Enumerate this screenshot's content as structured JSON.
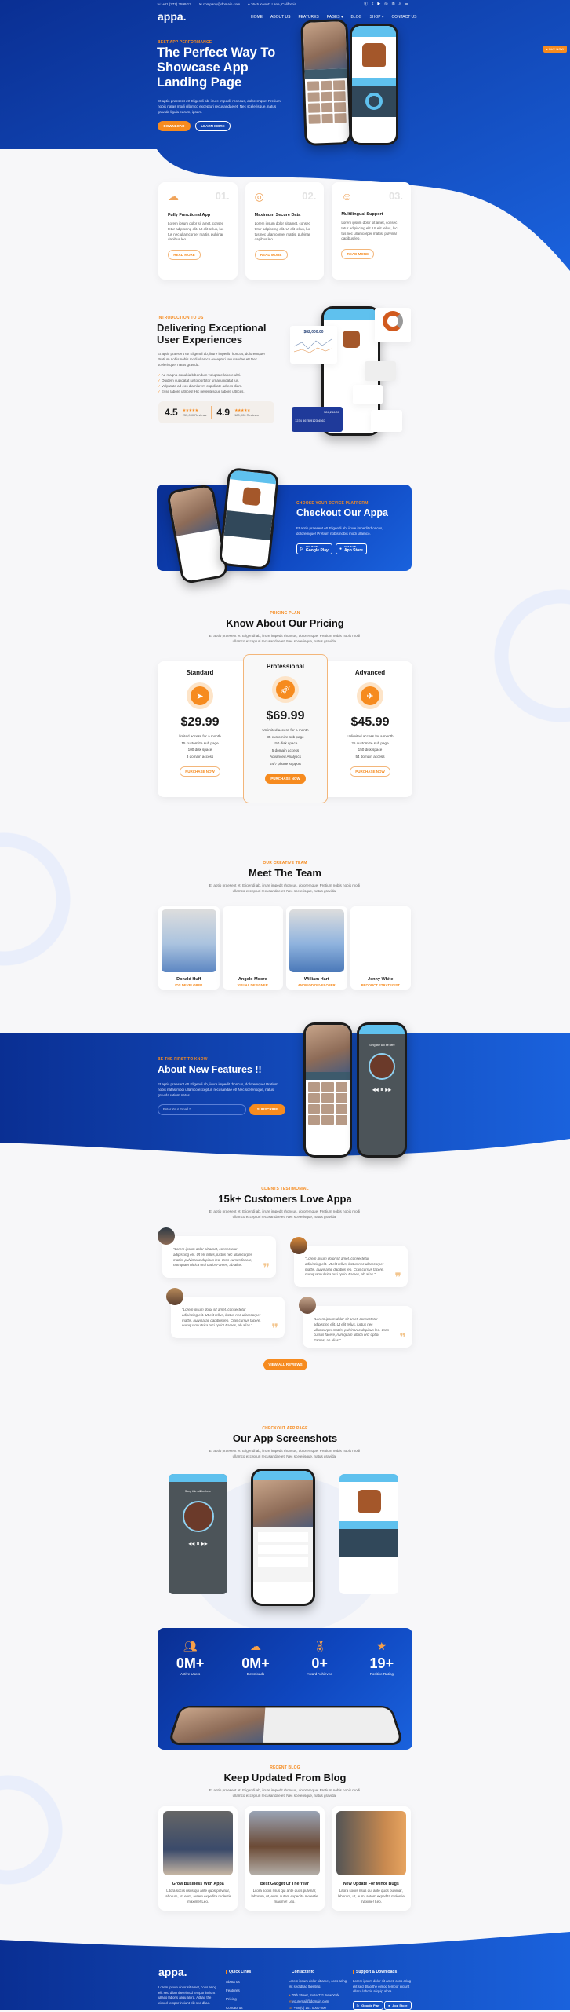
{
  "topbar": {
    "phone": "+01 (377) 2599 13",
    "email": "company@domain.com",
    "address": "3645 Koontz Lane, California",
    "social_icons": [
      "facebook-icon",
      "twitter-icon",
      "youtube-icon",
      "instagram-icon",
      "linkedin-icon",
      "search-icon",
      "menu-icon"
    ]
  },
  "nav": {
    "logo": "appa.",
    "items": [
      "HOME",
      "ABOUT US",
      "FEATURES",
      "PAGES",
      "BLOG",
      "SHOP",
      "CONTACT US"
    ],
    "active": "HOME"
  },
  "buy_now": "BUY NOW",
  "colors": {
    "primary": "#0f47c0",
    "accent": "#f68b1f"
  },
  "hero": {
    "tag": "BEST APP PERFORMANCE",
    "title": "The Perfect Way To Showcase App Landing Page",
    "text": "Et aptio praesent et! Eligendi ab, iirure impedit rhoncus, doloremque! Pretium nobis natas modi ullamco excepturi recusandae et! Nec scelerisque, natus gravida ligula earum, ipsam.",
    "download": "DOWNLOAD",
    "learn": "LEARN MORE"
  },
  "features": [
    {
      "num": "01.",
      "title": "Fully Functional App",
      "text": "Lorem ipsum dolor sit amet, consec tetur adipiscing elit. Ut elit tellus, luc tus nec ullamcorper mattis, pulvinar dapibus leo.",
      "btn": "READ MORE",
      "icon": "cloud-network-icon"
    },
    {
      "num": "02.",
      "title": "Maximum Secure Data",
      "text": "Lorem ipsum dolor sit amet, consec tetur adipiscing elit. Ut elit tellus, luc tus nec ullamcorper mattis, pulvinar dapibus leo.",
      "btn": "READ MORE",
      "icon": "secure-user-icon"
    },
    {
      "num": "03.",
      "title": "Multilingual Support",
      "text": "Lorem ipsum dolor sit amet, consec tetur adipiscing elit. Ut elit tellus, luc tus nec ullamcorper mattis, pulvinar dapibus leo.",
      "btn": "READ MORE",
      "icon": "chat-group-icon"
    }
  ],
  "intro": {
    "tag": "INTRODUCTION TO US",
    "title": "Delivering Exceptional User Experiences",
    "text": "Et aptio praesent et! Eligendi ab, iirure impedit rhoncus, doloremque! Pretium nobis nobis modi ullamco excepturi recusandae et! Nec scelerisque, natus gravida.",
    "list": [
      "Ad magna conubia bibendum voluptate labore ultri.",
      "Quidem cupidatat justo porttitor urnacupidatat jus.",
      "Vulputate ad eos diamlarem cupiditate ad eos diam.",
      "Esse labore ultrices! Hic pellentesque labore ultrices."
    ],
    "rating1": "4.5",
    "reviews1": "255,000 Reviews",
    "rating2": "4.9",
    "reviews2": "180,000 Reviews",
    "mock": {
      "balance": "$82,000.00",
      "card_no": "1234 5678 9123 4567",
      "card_amount": "$24,256.00"
    }
  },
  "checkout": {
    "tag": "CHOOSE YOUR DEVICE PLATFORM",
    "title": "Checkout Our Appa",
    "text": "Et aptio praesent et! Eligendi ab, iirure impedit rhoncus, doloremque! Pretium nobis nobis modi ullamco.",
    "google_small": "GET IT ON",
    "google": "Google Play",
    "apple_small": "GET IT ON",
    "apple": "App Store"
  },
  "pricing": {
    "tag": "PRICING PLAN",
    "title": "Know About Our Pricing",
    "text": "Et aptio praesent et! Eligendi ab, iirure impedit rhoncus, doloremque! Pretium nobis nobis modi ullamco excepturi recusandae et! Nec scelerisque, natus gravida.",
    "plans": [
      {
        "name": "Standard",
        "price": "$29.99",
        "features": [
          "limited access for a month",
          "15 customize sub page",
          "100 disk space",
          "3 domain access"
        ],
        "btn": "PURCHASE NOW",
        "icon": "paper-plane-icon"
      },
      {
        "name": "Professional",
        "price": "$69.99",
        "features": [
          "Unlimited access for a month",
          "35 customize sub page",
          "150 disk space",
          "5 domain access",
          "Advanced Analytics",
          "24/7 phone support"
        ],
        "btn": "PURCHASE NOW",
        "icon": "rocket-icon"
      },
      {
        "name": "Advanced",
        "price": "$45.99",
        "features": [
          "Unlimited access for a month",
          "25 customize sub page",
          "150 disk space",
          "54 domain access"
        ],
        "btn": "PURCHASE NOW",
        "icon": "airplane-icon"
      }
    ]
  },
  "team": {
    "tag": "OUR CREATIVE TEAM",
    "title": "Meet The Team",
    "text": "Et aptio praesent et! Eligendi ab, iirure impedit rhoncus, doloremque! Pretium nobis nobis modi ullamco excepturi recusandae et! Nec scelerisque, natus gravida.",
    "members": [
      {
        "name": "Donald Huff",
        "role": "IOS DEVELOPER"
      },
      {
        "name": "Angelo Moore",
        "role": "VISUAL DESIGNER"
      },
      {
        "name": "William Hart",
        "role": "ANDRIOD DEVELOPER"
      },
      {
        "name": "Jenny White",
        "role": "PRODUCT STRATEGIST"
      }
    ]
  },
  "newsletter": {
    "tag": "BE THE FIRST TO KNOW",
    "title": "About New Features !!",
    "text": "Et aptio praesent et! Eligendi ab, iirure impedit rhoncus, doloremque! Pretium nobis natas modi ullamco excepturi recusandae et! Nec scelerisque, natus gravida retium natas.",
    "placeholder": "Enter Your Email *",
    "btn": "SUBSCRIBE",
    "song": "Song title will be here"
  },
  "testimonials": {
    "tag": "CLIENTS TESTIMONIAL",
    "title": "15k+ Customers Love Appa",
    "text": "Et aptio praesent et! Eligendi ab, iirure impedit rhoncus, doloremque! Pretium nobis nobis modi ullamco excepturi recusandae et! Nec scelerisque, natus gravida.",
    "items": [
      "\"Lorem ipsum dolor sit amet, consectetur adipiscing elit. Ut elit tellus, luctus nec ullamcorper mattis, pulvinarac dapibus leo. Cras cursus facere, numquam ultrica orci optio! Fames, ab alias.\"",
      "\"Lorem ipsum dolor sit amet, consectetur adipiscing elit. Ut elit tellus, luctus nec ullamcorper mattis, pulvinarac dapibus leo. Cras cursus facere, numquam ultrica orci optio! Fames, ab alias.\"",
      "\"Lorem ipsum dolor sit amet, consectetur adipiscing elit. Ut elit tellus, luctus nec ullamcorper mattis, pulvinarac dapibus leo. Cras cursus facere, numquam ultrica orci optio! Fames, ab alias.\"",
      "\"Lorem ipsum dolor sit amet, consectetur adipiscing elit. Ut elit tellus, luctus nec ullamcorper mattis, pulvinarac dapibus leo. Cras cursus facere, numquam ultrica orci optio! Fames, ab alias.\""
    ],
    "btn": "VIEW ALL REVIEWS"
  },
  "screens": {
    "tag": "CHECKOUT APP PAGE",
    "title": "Our App Screenshots",
    "text": "Et aptio praesent et! Eligendi ab, iirure impedit rhoncus, doloremque! Pretium nobis nobis modi ullamco excepturi recusandae et! Nec scelerisque, natus gravida.",
    "song": "Song title will be here"
  },
  "stats": [
    {
      "value": "0M+",
      "label": "Active Users",
      "icon": "users-icon"
    },
    {
      "value": "0M+",
      "label": "Downloads",
      "icon": "cloud-download-icon"
    },
    {
      "value": "0+",
      "label": "Award Achieved",
      "icon": "medal-icon"
    },
    {
      "value": "19+",
      "label": "Positive Rating",
      "icon": "rating-person-icon"
    }
  ],
  "blog": {
    "tag": "RECENT BLOG",
    "title": "Keep Updated From Blog",
    "text": "Et aptio praesent et! Eligendi ab, iirure impedit rhoncus, doloremque! Pretium nobis nobis modi ullamco excepturi recusandae et! Nec scelerisque, natus gravida.",
    "posts": [
      {
        "title": "Grow Business With Appa",
        "text": "Litora sociis risus qui ante quos pulvinar, laborum, ut, eum, autem expedita molestie maxime! Leo."
      },
      {
        "title": "Best Gadget Of The Year",
        "text": "Litora sociis risus qui ante quos pulvinar, laborum, ut, eum, autem expedita molestie maxime! Leo."
      },
      {
        "title": "New Update For Minor Bugs",
        "text": "Litora sociis risus qui ante quos pulvinar, laborum, ut, eum, autem expedita molestie maxime! Leo."
      }
    ]
  },
  "footer": {
    "logo": "appa.",
    "about": "Lorem ipsum dolor sit amet, cons aring elit sed dllao the eimod tempor inciunt ullaco laboris aliqu alora. Adliao the eimod tempor inciunt elit sed dllao.",
    "quick_title": "Quick Links",
    "quick": [
      "About us",
      "Features",
      "Pricing",
      "Contact us"
    ],
    "contact_title": "Contact Info",
    "contact_text": "Lorem ipsum dolor sit amet, cons aring elit sed dllao theriting.",
    "address": "70th Street, Suite 721 New York",
    "email": "youremail@domain.com",
    "phone": "+88 (0) 101 0000 000",
    "support_title": "Support & Downloads",
    "support_text": "Lorem ipsum dolor sit amet, cons aring elit sed dllao the eimod tempor inciunt ullaco laboris aliquip alora.",
    "google": "Google Play",
    "apple": "App Store"
  }
}
